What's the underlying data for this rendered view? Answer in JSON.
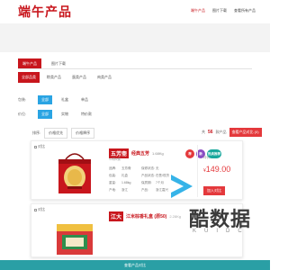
{
  "header": {
    "logo": "端午产品",
    "nav": [
      "端午产品",
      "图片下载",
      "查看所有产品"
    ]
  },
  "section_tabs": [
    "端午产品",
    "图片下载"
  ],
  "category_tabs": [
    "全部品类",
    "粽类产品",
    "蛋类产品",
    "肉类产品"
  ],
  "filters": [
    {
      "label": "包装:",
      "options": [
        "全部",
        "礼盒",
        "单品"
      ]
    },
    {
      "label": "价位:",
      "options": [
        "全部",
        "实物",
        "特价款"
      ]
    }
  ],
  "sort": {
    "label": "排序:",
    "options": [
      "价格优先",
      "价格降序"
    ],
    "count_prefix": "共",
    "count": "56",
    "count_suffix": "款产品",
    "compare_button": "查看产品对比 (0)"
  },
  "products": [
    {
      "compare": "对比",
      "brand": "五芳斋",
      "name": "经典五芳",
      "weight": "1.68Kg",
      "sub": "12粽6蛋",
      "specs": [
        [
          "品牌:",
          "五芳斋"
        ],
        [
          "保修状态:",
          "无"
        ],
        [
          "包装:",
          "礼盒"
        ],
        [
          "产品状态:",
          "在售/现货"
        ],
        [
          "重量:",
          "1.68kg"
        ],
        [
          "保质期:",
          "7个月"
        ],
        [
          "产地:",
          "浙江"
        ],
        [
          "产品:",
          "浙江嘉兴"
        ]
      ],
      "badges": [
        "荐",
        "新",
        "热卖推荐"
      ],
      "price_label": "特价",
      "currency": "¥",
      "price": "149.00",
      "buy": "加入对比"
    },
    {
      "compare": "对比",
      "brand": "江大",
      "name": "江米棕香礼盒 (原50)",
      "weight": "2.28Kg",
      "sub": "",
      "specs": [],
      "badges": [],
      "price_label": "",
      "currency": "",
      "price": "",
      "buy": ""
    }
  ],
  "watermark": {
    "text": "酷数据",
    "sub": [
      "K",
      "U",
      "I",
      "D",
      "C"
    ]
  },
  "footer": "查看产品对比"
}
